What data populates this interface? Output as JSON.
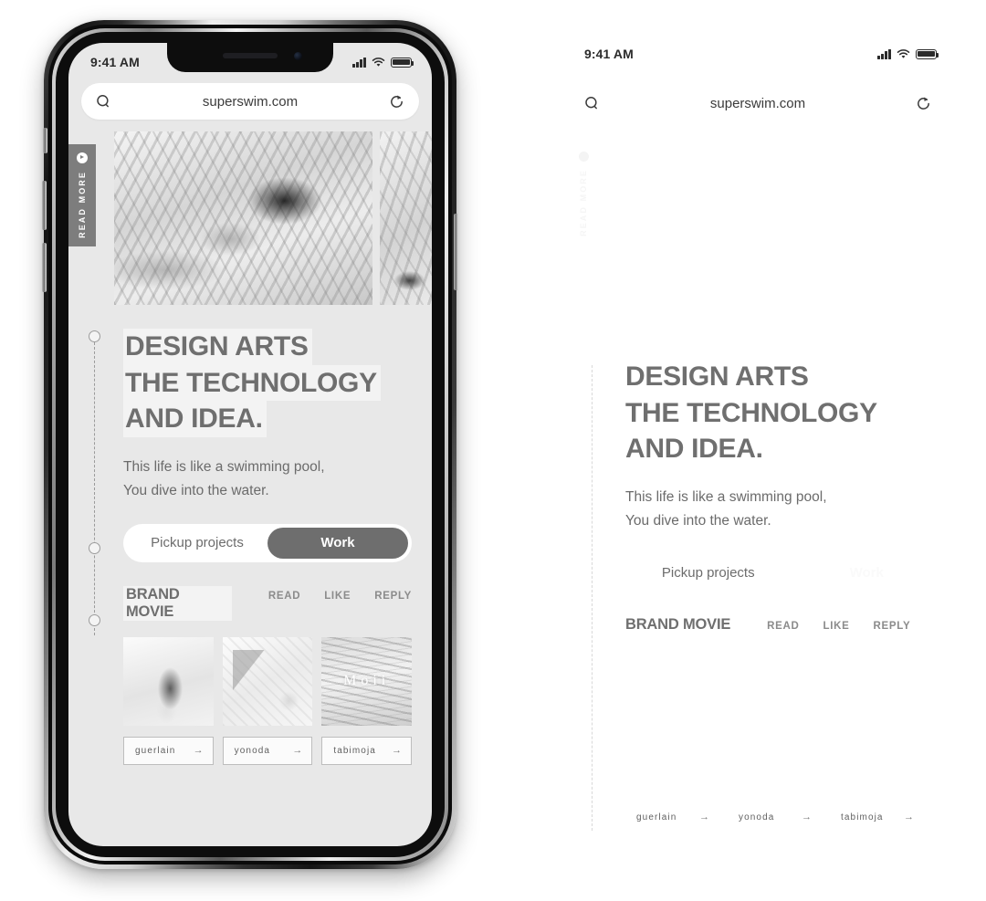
{
  "phone": {
    "status": {
      "time": "9:41 AM",
      "signal_icon": "signal-bars-icon",
      "wifi_icon": "wifi-icon",
      "battery_icon": "battery-icon"
    },
    "browser": {
      "url": "superswim.com",
      "search_icon": "search-icon",
      "reload_icon": "reload-icon"
    }
  },
  "readmore": {
    "label": "READ MORE",
    "icon": "play-circle-icon"
  },
  "hero": {
    "main_image": "underwater-swimmer-photo",
    "side_image": "underwater-hand-photo"
  },
  "headline": {
    "line1": "DESIGN ARTS",
    "line2": "THE TECHNOLOGY",
    "line3": "AND IDEA."
  },
  "subtitle": {
    "line1": "This life is like a swimming pool,",
    "line2": "You dive into the water."
  },
  "toggle": {
    "inactive": "Pickup projects",
    "active": "Work"
  },
  "brand": {
    "title": "BRAND MOVIE",
    "links": [
      "READ",
      "LIKE",
      "REPLY"
    ]
  },
  "thumbs": [
    {
      "name": "woman-back-photo",
      "caption": ""
    },
    {
      "name": "cosmetic-bottles-photo",
      "caption": ""
    },
    {
      "name": "texture-photo",
      "caption": "Moii"
    }
  ],
  "link_buttons": [
    {
      "label": "guerlain",
      "arrow": "→"
    },
    {
      "label": "yonoda",
      "arrow": "→"
    },
    {
      "label": "tabimoja",
      "arrow": "→"
    }
  ],
  "colors": {
    "screen_bg": "#e8e8e8",
    "headline": "#6f6f6f",
    "highlight": "#f3f3f3",
    "active_pill": "#6e6e6e",
    "tab_bg": "#7d7d7d"
  }
}
